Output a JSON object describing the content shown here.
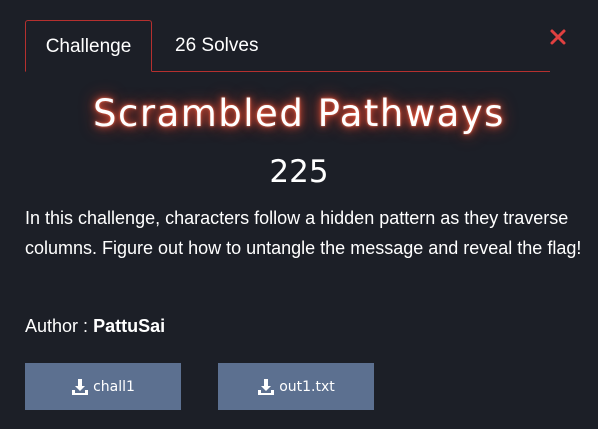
{
  "tabs": {
    "challenge_label": "Challenge",
    "solves_label": "26 Solves"
  },
  "challenge": {
    "title": "Scrambled Pathways",
    "points": "225",
    "description": "In this challenge, characters follow a hidden pattern as they traverse columns. Figure out how to untangle the message and reveal the flag!",
    "author_label": "Author :",
    "author_name": "PattuSai"
  },
  "files": [
    {
      "label": "chall1",
      "icon": "download-icon"
    },
    {
      "label": "out1.txt",
      "icon": "download-icon"
    }
  ],
  "colors": {
    "background": "#1c1f27",
    "accent": "#b5302f",
    "button": "#5c7090",
    "close": "#e04040"
  }
}
